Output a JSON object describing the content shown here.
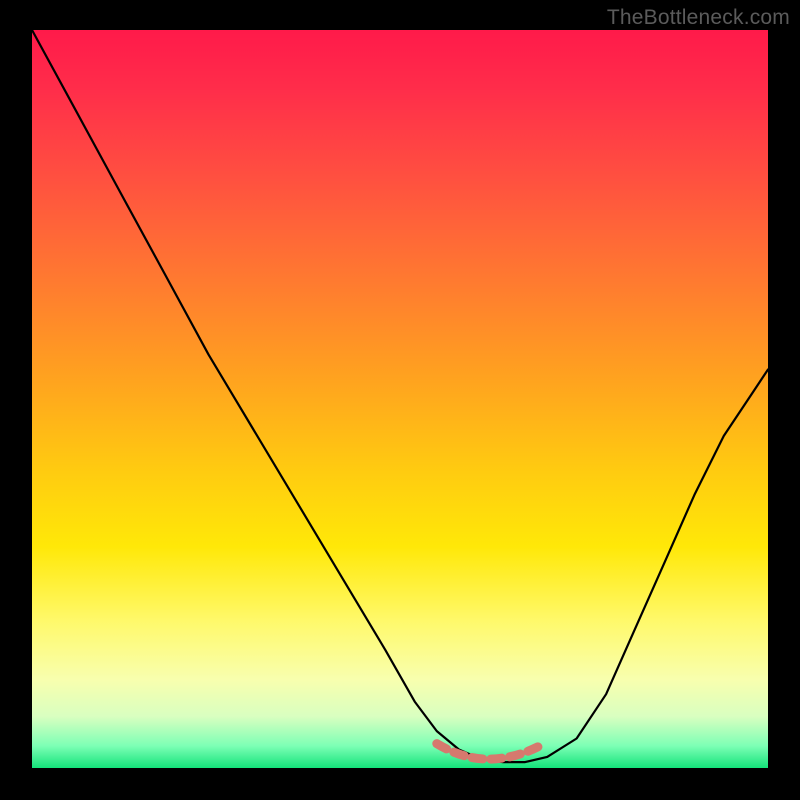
{
  "watermark": "TheBottleneck.com",
  "colors": {
    "curve_stroke": "#000000",
    "dash_stroke": "#d6796e",
    "frame_bg": "#000000"
  },
  "chart_data": {
    "type": "line",
    "title": "",
    "xlabel": "",
    "ylabel": "",
    "xlim": [
      0,
      100
    ],
    "ylim": [
      0,
      100
    ],
    "series": [
      {
        "name": "bottleneck-curve",
        "x": [
          0,
          6,
          12,
          18,
          24,
          30,
          36,
          42,
          48,
          52,
          55,
          58,
          61,
          64,
          67,
          70,
          74,
          78,
          82,
          86,
          90,
          94,
          98,
          100
        ],
        "y": [
          100,
          89,
          78,
          67,
          56,
          46,
          36,
          26,
          16,
          9,
          5,
          2.5,
          1.2,
          0.8,
          0.8,
          1.5,
          4,
          10,
          19,
          28,
          37,
          45,
          51,
          54
        ]
      }
    ],
    "optimal_zone": {
      "x_start": 55,
      "x_end": 69,
      "y": 1.8
    }
  }
}
